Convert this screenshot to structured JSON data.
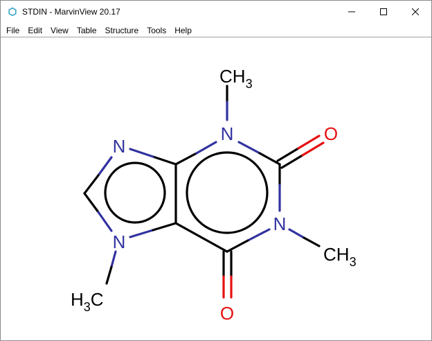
{
  "window": {
    "title": "STDIN - MarvinView 20.17"
  },
  "menu": {
    "items": [
      {
        "id": "file",
        "label": "File"
      },
      {
        "id": "edit",
        "label": "Edit"
      },
      {
        "id": "view",
        "label": "View"
      },
      {
        "id": "table",
        "label": "Table"
      },
      {
        "id": "structure",
        "label": "Structure"
      },
      {
        "id": "tools",
        "label": "Tools"
      },
      {
        "id": "help",
        "label": "Help"
      }
    ]
  },
  "molecule": {
    "atoms": {
      "ch3_top": {
        "main": "CH",
        "sub": "3"
      },
      "n_top": {
        "main": "N"
      },
      "o_right": {
        "main": "O"
      },
      "n_right": {
        "main": "N"
      },
      "ch3_right": {
        "main": "CH",
        "sub": "3"
      },
      "o_bottom": {
        "main": "O"
      },
      "n_left_top": {
        "main": "N"
      },
      "n_left_bottom": {
        "main": "N"
      },
      "h3c_bottom": {
        "main": "H",
        "sub": "3",
        "tail": "C"
      }
    },
    "colors": {
      "bond": "#000000",
      "nitrogen": "#3232a0",
      "oxygen": "#e61010"
    }
  }
}
